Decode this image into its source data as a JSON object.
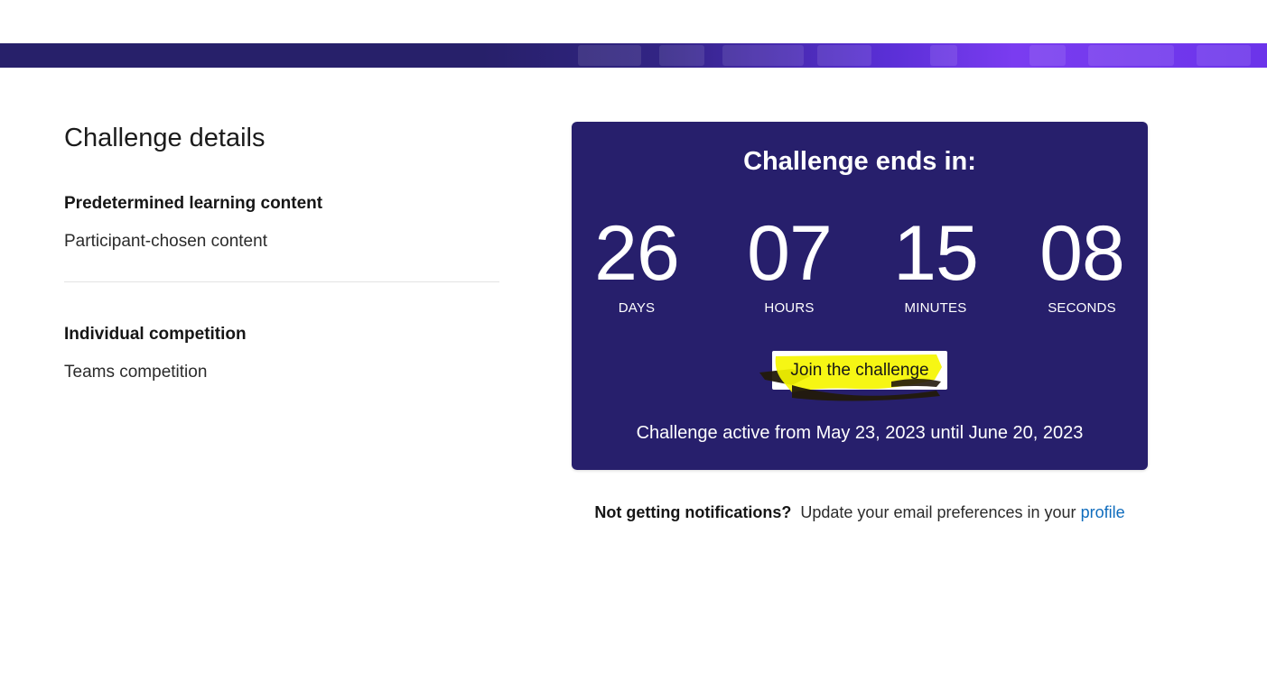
{
  "details": {
    "heading": "Challenge details",
    "groups": [
      {
        "label": "Predetermined learning content",
        "value": "Participant-chosen content"
      },
      {
        "label": "Individual competition",
        "value": "Teams competition"
      }
    ]
  },
  "countdown": {
    "title": "Challenge ends in:",
    "units": [
      {
        "value": "26",
        "label": "DAYS"
      },
      {
        "value": "07",
        "label": "HOURS"
      },
      {
        "value": "15",
        "label": "MINUTES"
      },
      {
        "value": "08",
        "label": "SECONDS"
      }
    ],
    "join_label": "Join the challenge",
    "active_text": "Challenge active from May 23, 2023 until June 20, 2023"
  },
  "notifications": {
    "prefix": "Not getting notifications?",
    "text": "Update your email preferences in your",
    "link": "profile"
  },
  "colors": {
    "card_bg": "#271f6c",
    "link": "#0f6cbd",
    "highlight": "#f5f500"
  }
}
